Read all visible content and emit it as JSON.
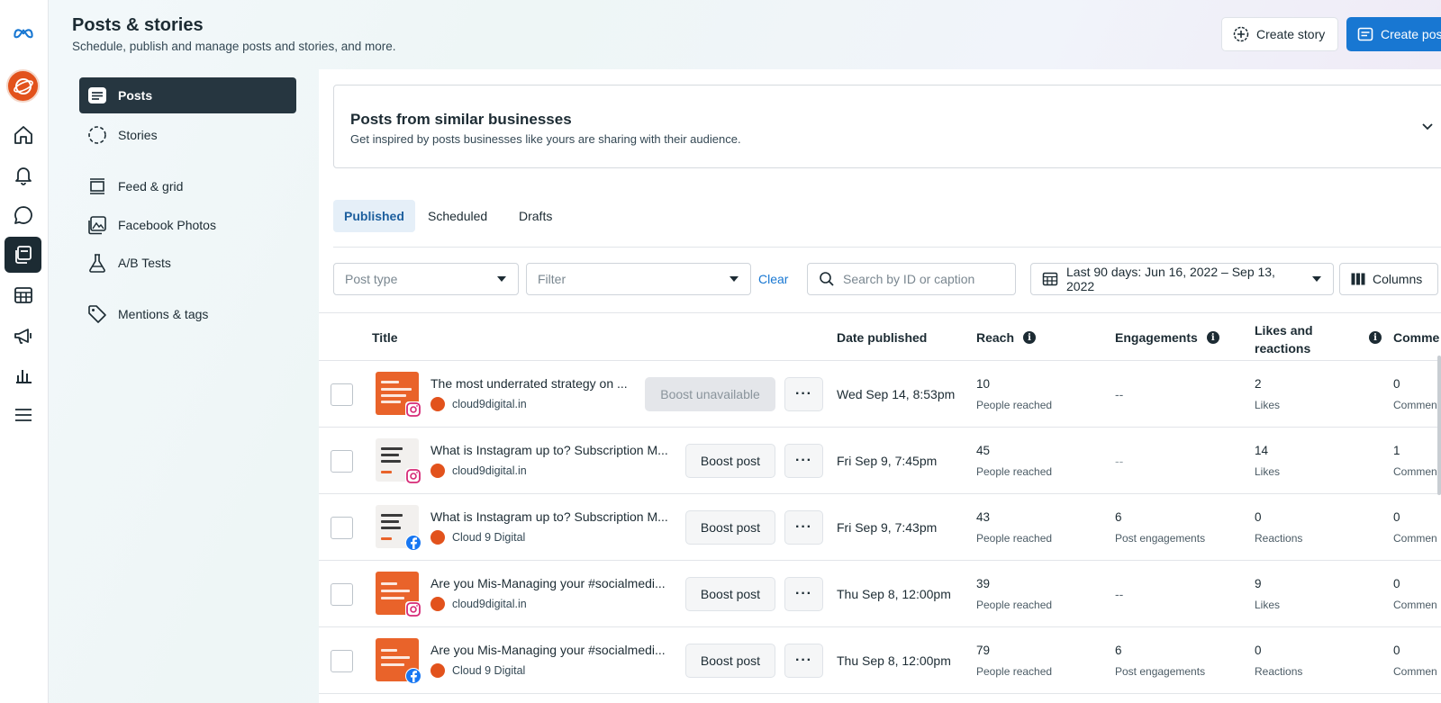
{
  "header": {
    "title": "Posts & stories",
    "subtitle": "Schedule, publish and manage posts and stories, and more.",
    "create_story": "Create story",
    "create_post": "Create post"
  },
  "rail": {
    "icons": [
      "meta-logo-icon",
      "home-icon",
      "notifications-icon",
      "messages-icon",
      "posts-stories-icon",
      "content-table-icon",
      "ads-megaphone-icon",
      "insights-chart-icon",
      "menu-icon"
    ]
  },
  "subnav": {
    "items": [
      {
        "label": "Posts",
        "icon": "posts-icon"
      },
      {
        "label": "Stories",
        "icon": "stories-icon"
      },
      {
        "label": "Feed & grid",
        "icon": "feed-grid-icon"
      },
      {
        "label": "Facebook Photos",
        "icon": "photos-icon"
      },
      {
        "label": "A/B Tests",
        "icon": "flask-icon"
      },
      {
        "label": "Mentions & tags",
        "icon": "tag-icon"
      }
    ]
  },
  "similar": {
    "title": "Posts from similar businesses",
    "subtitle": "Get inspired by posts businesses like yours are sharing with their audience."
  },
  "tabs": [
    "Published",
    "Scheduled",
    "Drafts"
  ],
  "filters": {
    "post_type": "Post type",
    "filter": "Filter",
    "clear": "Clear",
    "search_placeholder": "Search by ID or caption",
    "date_range": "Last 90 days: Jun 16, 2022 – Sep 13, 2022",
    "columns": "Columns"
  },
  "table": {
    "headers": {
      "title": "Title",
      "date": "Date published",
      "reach": "Reach",
      "engagements": "Engagements",
      "likes_line1": "Likes and",
      "likes_line2": "reactions",
      "comments": "Comme"
    },
    "rows": [
      {
        "title": "The most underrated strategy on ...",
        "account": "cloud9digital.in",
        "platform": "instagram",
        "thumb": "orange",
        "boost": "Boost unavailable",
        "date": "Wed Sep 14, 8:53pm",
        "reach": "10",
        "reach_label": "People reached",
        "engagements": "--",
        "engagements_label": "",
        "likes": "2",
        "likes_label": "Likes",
        "comments": "0",
        "comments_label": "Commen"
      },
      {
        "title": "What is Instagram up to? Subscription M...",
        "account": "cloud9digital.in",
        "platform": "instagram",
        "thumb": "light",
        "boost": "Boost post",
        "date": "Fri Sep 9, 7:45pm",
        "reach": "45",
        "reach_label": "People reached",
        "engagements": "--",
        "engagements_label": "",
        "likes": "14",
        "likes_label": "Likes",
        "comments": "1",
        "comments_label": "Commen"
      },
      {
        "title": "What is Instagram up to? Subscription M...",
        "account": "Cloud 9 Digital",
        "platform": "facebook",
        "thumb": "light",
        "boost": "Boost post",
        "date": "Fri Sep 9, 7:43pm",
        "reach": "43",
        "reach_label": "People reached",
        "engagements": "6",
        "engagements_label": "Post engagements",
        "likes": "0",
        "likes_label": "Reactions",
        "comments": "0",
        "comments_label": "Commen"
      },
      {
        "title": "Are you Mis-Managing your #socialmedi...",
        "account": "cloud9digital.in",
        "platform": "instagram",
        "thumb": "orange",
        "boost": "Boost post",
        "date": "Thu Sep 8, 12:00pm",
        "reach": "39",
        "reach_label": "People reached",
        "engagements": "--",
        "engagements_label": "",
        "likes": "9",
        "likes_label": "Likes",
        "comments": "0",
        "comments_label": "Commen"
      },
      {
        "title": "Are you Mis-Managing your #socialmedi...",
        "account": "Cloud 9 Digital",
        "platform": "facebook",
        "thumb": "orange",
        "boost": "Boost post",
        "date": "Thu Sep 8, 12:00pm",
        "reach": "79",
        "reach_label": "People reached",
        "engagements": "6",
        "engagements_label": "Post engagements",
        "likes": "0",
        "likes_label": "Reactions",
        "comments": "0",
        "comments_label": "Commen"
      }
    ]
  },
  "colors": {
    "accent": "#1877d2",
    "dark": "#1c2b33",
    "brand_orange": "#e2521c"
  }
}
